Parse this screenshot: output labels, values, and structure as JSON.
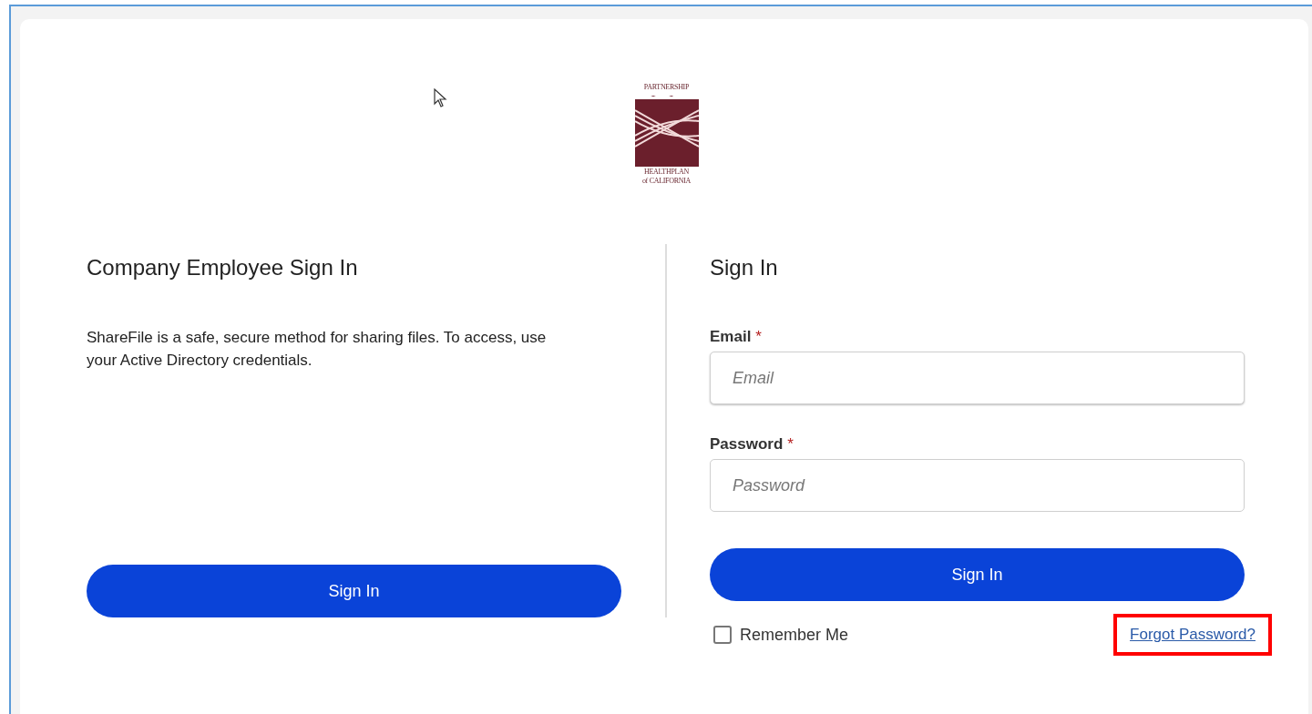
{
  "logo": {
    "top_text": "PARTNERSHIP",
    "bottom_text": "HEALTHPLAN",
    "subtitle": "of CALIFORNIA"
  },
  "employee_panel": {
    "title": "Company Employee Sign In",
    "description": "ShareFile is a safe, secure method for sharing files. To access, use your Active Directory credentials.",
    "button": "Sign In"
  },
  "sign_in_panel": {
    "title": "Sign In",
    "fields": [
      {
        "label": "Email",
        "required_mark": "*",
        "placeholder": "Email"
      },
      {
        "label": "Password",
        "required_mark": "*",
        "placeholder": "Password"
      }
    ],
    "button": "Sign In",
    "remember": {
      "label": "Remember Me",
      "checked": false
    },
    "forgot_link": {
      "label": "Forgot Password?",
      "highlighted": true
    }
  }
}
